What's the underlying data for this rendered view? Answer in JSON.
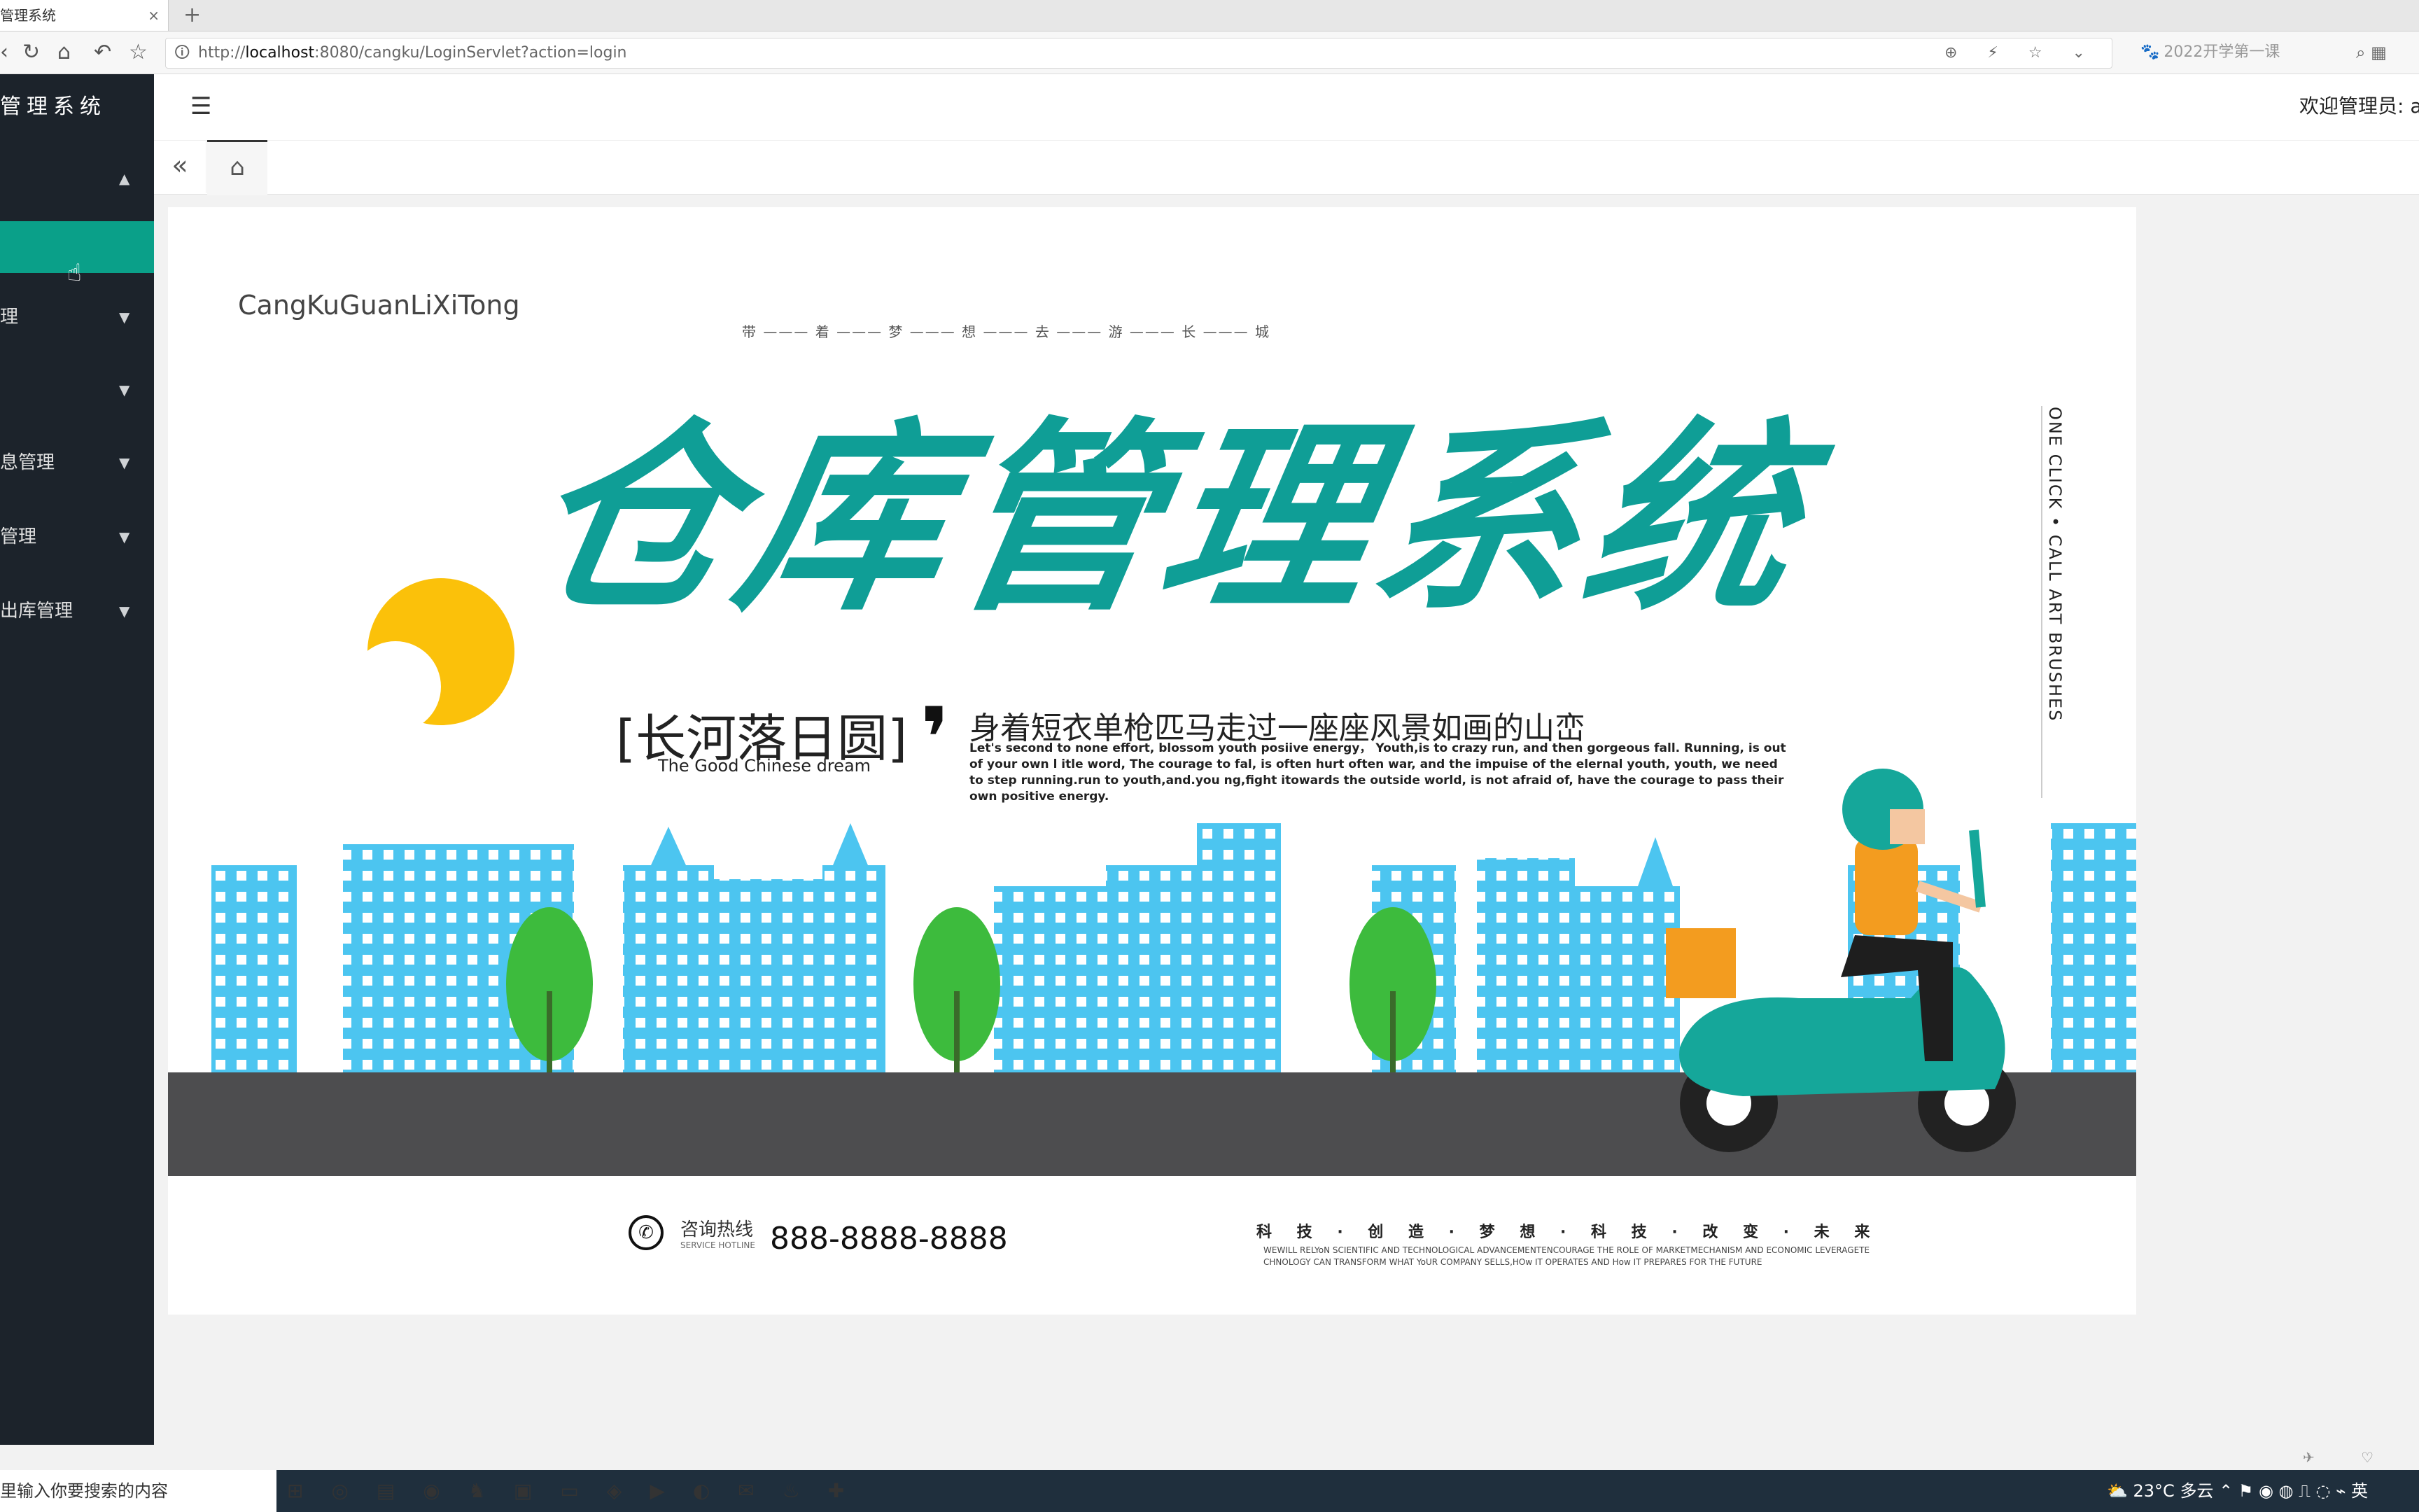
{
  "browser": {
    "tab_title": "管理系统",
    "tab_close": "×",
    "new_tab": "+",
    "nav": {
      "back": "‹",
      "reload": "↻",
      "home": "⌂",
      "undo": "↶",
      "star": "☆"
    },
    "url_host": "localhost",
    "url_rest": ":8080/cangku/LoginServlet?action=login",
    "url_prefix": "http://",
    "url_tools": "⊕ ⚡ ☆ ⌄",
    "side_search": "2022开学第一课",
    "side_search_icon": "🐾",
    "right_buttons": "⌕  ▦"
  },
  "sidebar": {
    "brand": "管理系统",
    "items": [
      {
        "label": "",
        "arrow": "▲"
      },
      {
        "label": "理",
        "arrow": "▼"
      },
      {
        "label": "",
        "arrow": "▼"
      },
      {
        "label": "息管理",
        "arrow": "▼"
      },
      {
        "label": "管理",
        "arrow": "▼"
      },
      {
        "label": "出库管理",
        "arrow": "▼"
      }
    ],
    "active_color": "#0aa089",
    "cursor": "☝"
  },
  "header": {
    "toggle_icon": "☰",
    "welcome": "欢迎管理员: ad",
    "tab_left_icon": "«",
    "home_tab_icon": "⌂"
  },
  "poster": {
    "pinyin": "CangKuGuanLiXiTong",
    "slogan": "带 ——— 着 ——— 梦 ——— 想 ——— 去 ——— 游 ——— 长 ——— 城",
    "title": "仓库管理系统",
    "vertical_text": "ONE CLICK • CALL ART BRUSHES",
    "poem_left": "[长河落日圆]",
    "poem_left_sub": "The Good Chinese dream",
    "comma": "❜",
    "poem_right": "身着短衣单枪匹马走过一座座风景如画的山峦",
    "poem_en": "Let's second to none effort, blossom youth posiive energy， Youth,is to crazy run, and then gorgeous fall. Running, is out of your own l itle word, The courage to fal, is often hurt often war, and the impuise of the elernal youth, youth, we need to step running.run to youth,and.you ng,fight itowards the outside world, is not afraid of, have the courage to pass their own positive energy.",
    "hotline_icon": "✆",
    "hotline_label": "咨询热线",
    "hotline_sub": "SERVICE HOTLINE",
    "hotline_number": "888-8888-8888",
    "tech_cn": "科 技 · 创 造 · 梦 想 · 科 技 · 改 变 · 未 来",
    "tech_en": "WEWILL RELYoN SCIENTIFIC AND TECHNOLOGICAL ADVANCEMENTENCOURAGE THE ROLE OF MARKETMECHANISM AND ECONOMIC LEVERAGETE CHNOLOGY CAN TRANSFORM WHAT YoUR COMPANY SELLS,HOw IT OPERATES AND How IT PREPARES FOR THE FUTURE",
    "colors": {
      "title": "#0f9e96",
      "sun": "#fbc10a",
      "buildings": "#4cc5f0",
      "road": "#4d4d4f",
      "tree": "#3dbb3d",
      "scooter": "#15a79a"
    }
  },
  "taskbar": {
    "search_placeholder": "里输入你要搜索的内容",
    "icons": "⊞◎▤◉♞▣▭◈▶◐✉♨✚",
    "weather": "⛅ 23°C 多云  ⌃ ⚑ ◉ ◍ ⎍ ◌ ⌁ 英"
  },
  "status_strip": "✈ ♡ ⎙"
}
